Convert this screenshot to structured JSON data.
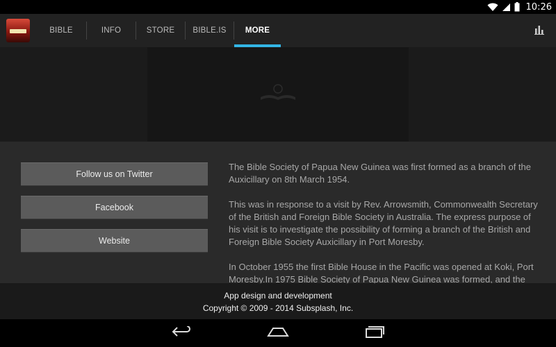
{
  "status_bar": {
    "time": "10:26"
  },
  "action_bar": {
    "tabs": [
      {
        "label": "BIBLE",
        "active": false
      },
      {
        "label": "INFO",
        "active": false
      },
      {
        "label": "STORE",
        "active": false
      },
      {
        "label": "BIBLE.IS",
        "active": false
      },
      {
        "label": "MORE",
        "active": true
      }
    ],
    "accent_color": "#33b5e5"
  },
  "buttons": {
    "twitter": "Follow us on Twitter",
    "facebook": "Facebook",
    "website": "Website"
  },
  "about": {
    "p1": "The Bible Society of Papua New Guinea was first formed as a branch of the Auxicillary on 8th March 1954.",
    "p2": "This was in response to a visit by Rev. Arrowsmith, Commonwealth Secretary of the British and Foreign Bible Society in Australia. The express purpose of his visit is to investigate the possibility of forming a branch of the British and Foreign Bible Society Auxicillary in Port Moresby.",
    "p3": "In October 1955 the first Bible House in the Pacific was opened at Koki, Port Moresby.In 1975 Bible Society of Papua New Guinea was formed, and the"
  },
  "footer": {
    "line1": "App design and development",
    "line2": "Copyright © 2009 - 2014 Subsplash, Inc."
  },
  "icons": {
    "wifi": "wifi-icon",
    "signal": "signal-icon",
    "battery": "battery-icon",
    "stats": "bar-chart-icon",
    "back": "back-icon",
    "home": "home-icon",
    "recents": "recents-icon"
  }
}
